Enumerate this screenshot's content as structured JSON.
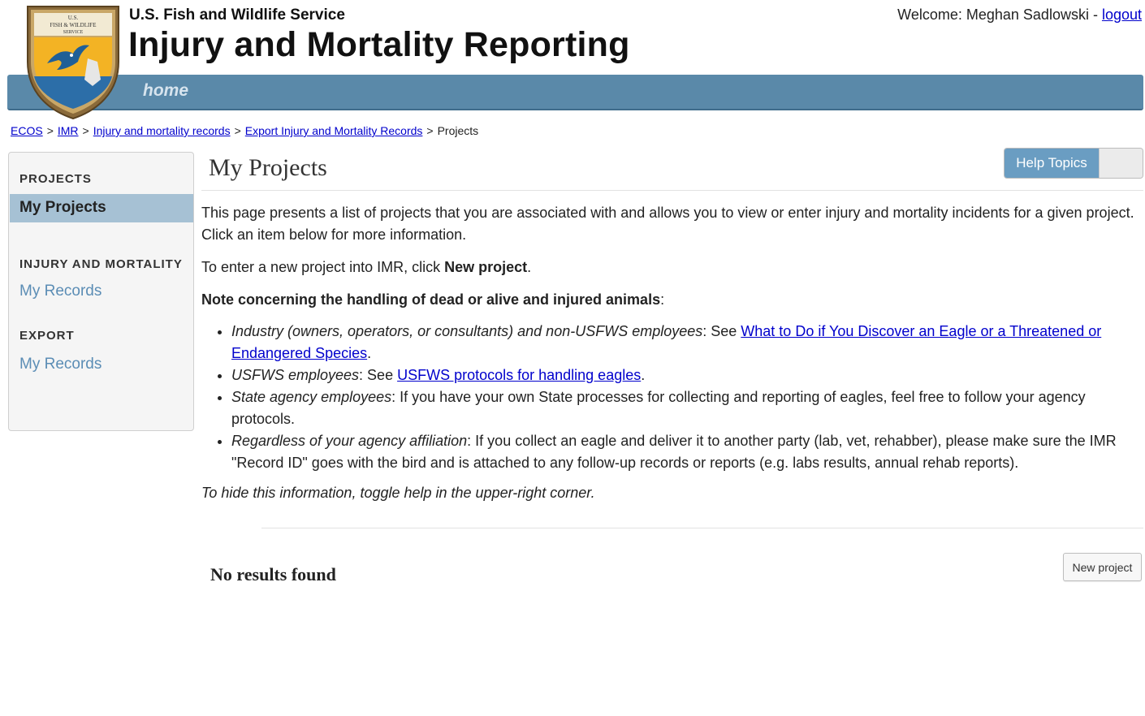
{
  "header": {
    "logo_text": [
      "U.S.",
      "FISH & WILDLIFE",
      "SERVICE"
    ],
    "agency": "U.S. Fish and Wildlife Service",
    "app_title": "Injury and Mortality Reporting",
    "welcome_prefix": "Welcome: Meghan Sadlowski - ",
    "logout": "logout"
  },
  "nav": {
    "home": "home"
  },
  "breadcrumb": {
    "items": [
      "ECOS",
      "IMR",
      "Injury and mortality records",
      "Export Injury and Mortality Records",
      "Projects"
    ],
    "separator": ">"
  },
  "sidebar": {
    "projects_heading": "PROJECTS",
    "projects_active": "My Projects",
    "injury_heading": "INJURY AND MORTALITY",
    "injury_link": "My Records",
    "export_heading": "EXPORT",
    "export_link": "My Records"
  },
  "main": {
    "title": "My Projects",
    "help_toggle_label": "Help Topics",
    "intro": "This page presents a list of projects that you are associated with and allows you to view or enter injury and mortality incidents for a given project. Click an item below for more information.",
    "new_project_prefix": "To enter a new project into IMR, click ",
    "new_project_bold": "New project",
    "new_project_suffix": ".",
    "note_bold": "Note concerning the handling of dead or alive and injured animals",
    "note_suffix": ":",
    "bullets": [
      {
        "italic": "Industry (owners, operators, or consultants) and non-USFWS employees",
        "text": ": See ",
        "link": "What to Do if You Discover an Eagle or a Threatened or Endangered Species",
        "suffix": "."
      },
      {
        "italic": "USFWS employees",
        "text": ": See ",
        "link": "USFWS protocols for handling eagles",
        "suffix": "."
      },
      {
        "italic": "State agency employees",
        "text": ": If you have your own State processes for collecting and reporting of eagles, feel free to follow your agency protocols."
      },
      {
        "italic": "Regardless of your agency affiliation",
        "text": ": If you collect an eagle and deliver it to another party (lab, vet, rehabber), please make sure the IMR \"Record ID\" goes with the bird and is attached to any follow-up records or reports (e.g. labs results, annual rehab reports)."
      }
    ],
    "hint": "To hide this information, toggle help in the upper-right corner.",
    "no_results": "No results found",
    "new_project_button": "New project"
  },
  "colors": {
    "nav_bar": "#5a89a9",
    "sidebar_active": "#a6c1d4",
    "help_toggle": "#6a9dc2",
    "link": "#0000cc",
    "sidebar_link": "#5b8db5"
  },
  "icons": {
    "logo": "usfws-shield-logo"
  }
}
